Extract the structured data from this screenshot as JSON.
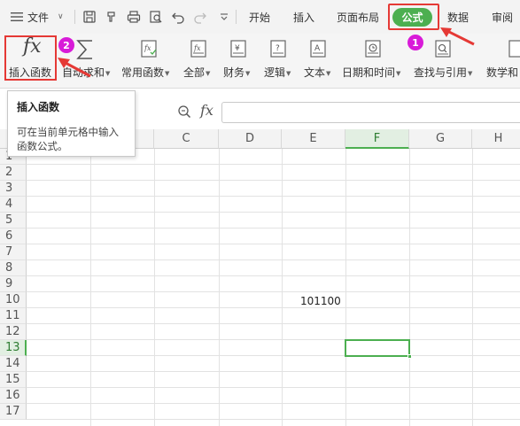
{
  "menubar": {
    "file_label": "文件",
    "tabs": [
      {
        "label": "开始"
      },
      {
        "label": "插入"
      },
      {
        "label": "页面布局"
      },
      {
        "label": "公式"
      },
      {
        "label": "数据"
      },
      {
        "label": "审阅"
      }
    ],
    "active_tab": "公式"
  },
  "ribbon": {
    "items": [
      {
        "label": "插入函数",
        "icon": "fx-icon"
      },
      {
        "label": "自动求和",
        "icon": "sigma-icon"
      },
      {
        "label": "常用函数",
        "icon": "common-functions-icon"
      },
      {
        "label": "全部",
        "icon": "all-functions-icon"
      },
      {
        "label": "财务",
        "icon": "finance-icon"
      },
      {
        "label": "逻辑",
        "icon": "logic-icon"
      },
      {
        "label": "文本",
        "icon": "text-icon"
      },
      {
        "label": "日期和时间",
        "icon": "datetime-icon"
      },
      {
        "label": "查找与引用",
        "icon": "lookup-icon"
      },
      {
        "label": "数学和",
        "icon": "math-icon"
      }
    ]
  },
  "tooltip": {
    "title": "插入函数",
    "description": "可在当前单元格中输入函数公式。"
  },
  "formula_bar": {
    "fx": "fx",
    "value": ""
  },
  "sheet": {
    "columns": [
      "C",
      "D",
      "E",
      "F",
      "G",
      "H"
    ],
    "active_column": "F",
    "rows": [
      "1",
      "2",
      "3",
      "4",
      "5",
      "6",
      "7",
      "8",
      "9",
      "10",
      "11",
      "12",
      "13",
      "14",
      "15",
      "16",
      "17"
    ],
    "active_row": "13",
    "cell_E10": "101100"
  },
  "annotations": {
    "step1": "1",
    "step2": "2"
  },
  "colors": {
    "accent_green": "#4caf50",
    "highlight_red": "#e53935",
    "badge_magenta": "#d81bd8"
  }
}
